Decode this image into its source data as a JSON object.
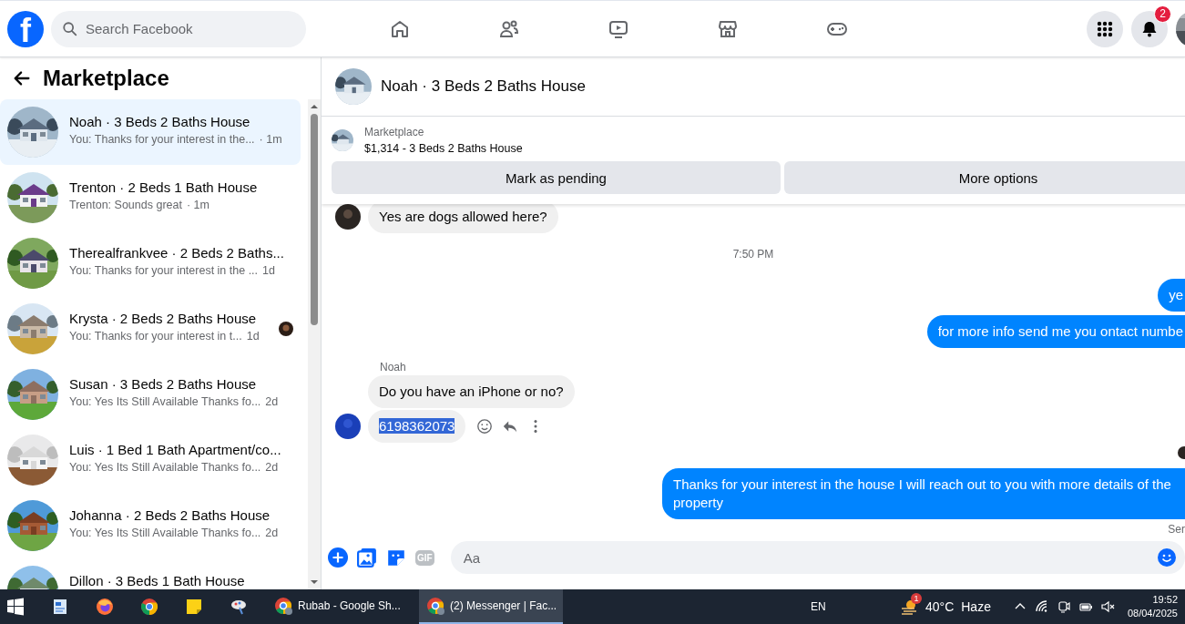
{
  "logo": "f",
  "search": {
    "placeholder": "Search Facebook"
  },
  "notifications": {
    "badge": "2"
  },
  "sidebar": {
    "title": "Marketplace",
    "conversations": [
      {
        "title": "Noah · 3 Beds 2 Baths House",
        "preview": "You: Thanks for your interest in the...",
        "time": "· 1m",
        "selected": true
      },
      {
        "title": "Trenton · 2 Beds 1 Bath House",
        "preview": "Trenton: Sounds great",
        "time": "· 1m",
        "selected": false
      },
      {
        "title": "Therealfrankvee · 2 Beds 2 Baths...",
        "preview": "You: Thanks for your interest in the ...",
        "time": "1d",
        "selected": false
      },
      {
        "title": "Krysta · 2 Beds 2 Baths House",
        "preview": "You: Thanks for your interest in t...",
        "time": "1d",
        "selected": false,
        "seen_avatar": true
      },
      {
        "title": "Susan · 3 Beds 2 Baths House",
        "preview": "You: Yes Its Still Available Thanks fo...",
        "time": "2d",
        "selected": false
      },
      {
        "title": "Luis · 1 Bed 1 Bath Apartment/co...",
        "preview": "You: Yes Its Still Available Thanks fo...",
        "time": "2d",
        "selected": false
      },
      {
        "title": "Johanna · 2 Beds 2 Baths House",
        "preview": "You: Yes Its Still Available Thanks fo...",
        "time": "2d",
        "selected": false
      },
      {
        "title": "Dillon · 3 Beds 1 Bath House",
        "selected": false
      }
    ]
  },
  "chat": {
    "title": "Noah · 3 Beds 2 Baths House",
    "listing": {
      "source": "Marketplace",
      "price_title": "$1,314 - 3 Beds 2 Baths House"
    },
    "actions": [
      "Mark as pending",
      "More options"
    ],
    "messages": [
      {
        "kind": "incoming",
        "text": "Yes are dogs allowed here?",
        "avatar": true
      },
      {
        "kind": "time",
        "text": "7:50 PM"
      },
      {
        "kind": "outgoing",
        "text": "ye"
      },
      {
        "kind": "outgoing",
        "text": "for more info send me you ontact numbe"
      },
      {
        "kind": "sender",
        "text": "Noah"
      },
      {
        "kind": "incoming",
        "text": "Do you have an iPhone or no?"
      },
      {
        "kind": "incoming",
        "text": "6198362073",
        "avatar": true,
        "highlighted": true,
        "actions": true
      },
      {
        "kind": "seen"
      },
      {
        "kind": "outgoing",
        "text": "Thanks for your interest in the house I will reach out to you with more details of the property"
      },
      {
        "kind": "status",
        "text": "Ser"
      }
    ],
    "composer": {
      "gif": "GIF",
      "placeholder": "Aa"
    }
  },
  "taskbar": {
    "windows": [
      {
        "label": "Rubab - Google Sh...",
        "selected": false
      },
      {
        "label": "(2) Messenger | Fac...",
        "selected": true
      }
    ],
    "language": "EN",
    "weather": {
      "badge": "1",
      "temperature": "40°C",
      "condition": "Haze"
    },
    "time": "19:52",
    "date": "08/04/2025"
  }
}
